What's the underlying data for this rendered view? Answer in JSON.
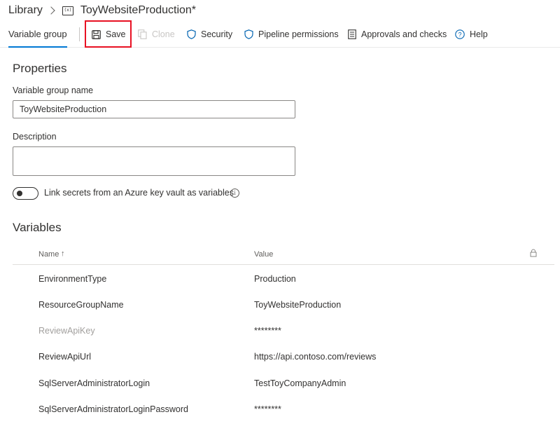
{
  "breadcrumb": {
    "library": "Library",
    "icon_text": "(x)",
    "title": "ToyWebsiteProduction*"
  },
  "toolbar": {
    "active_tab": "Variable group",
    "save": "Save",
    "clone": "Clone",
    "security": "Security",
    "pipeline_permissions": "Pipeline permissions",
    "approvals": "Approvals and checks",
    "help": "Help"
  },
  "properties": {
    "heading": "Properties",
    "name_label": "Variable group name",
    "name_value": "ToyWebsiteProduction",
    "description_label": "Description",
    "description_value": "",
    "keyvault_label": "Link secrets from an Azure key vault as variables",
    "info_glyph": "i"
  },
  "variables": {
    "heading": "Variables",
    "col_name": "Name",
    "sort_glyph": "↑",
    "col_value": "Value",
    "rows": [
      {
        "name": "EnvironmentType",
        "value": "Production"
      },
      {
        "name": "ResourceGroupName",
        "value": "ToyWebsiteProduction"
      },
      {
        "name": "ReviewApiKey",
        "value": "********"
      },
      {
        "name": "ReviewApiUrl",
        "value": "https://api.contoso.com/reviews"
      },
      {
        "name": "SqlServerAdministratorLogin",
        "value": "TestToyCompanyAdmin"
      },
      {
        "name": "SqlServerAdministratorLoginPassword",
        "value": "********"
      }
    ]
  },
  "colors": {
    "accent": "#0078d4",
    "highlight": "#e81123",
    "text": "#323130",
    "disabled": "#c8c6c4"
  }
}
